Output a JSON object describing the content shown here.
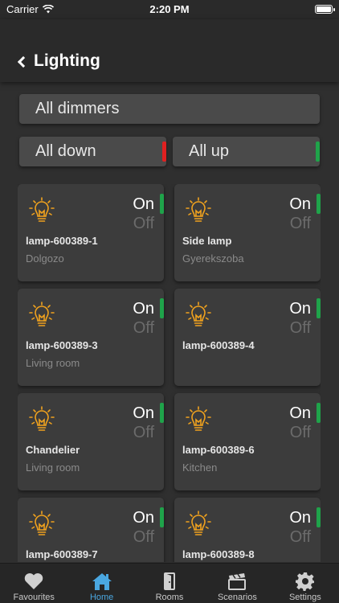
{
  "status_bar": {
    "carrier": "Carrier",
    "time": "2:20 PM"
  },
  "nav": {
    "title": "Lighting"
  },
  "controls": {
    "all_dimmers": "All dimmers",
    "all_down": "All down",
    "all_up": "All up",
    "all_down_indicator_color": "#e02020",
    "all_up_indicator_color": "#1fa34a"
  },
  "on_label": "On",
  "off_label": "Off",
  "lamps": [
    {
      "name": "lamp-600389-1",
      "room": "Dolgozo",
      "state": "on"
    },
    {
      "name": "Side lamp",
      "room": "Gyerekszoba",
      "state": "on"
    },
    {
      "name": "lamp-600389-3",
      "room": "Living room",
      "state": "on"
    },
    {
      "name": "lamp-600389-4",
      "room": "",
      "state": "on"
    },
    {
      "name": "Chandelier",
      "room": "Living room",
      "state": "on"
    },
    {
      "name": "lamp-600389-6",
      "room": "Kitchen",
      "state": "on"
    },
    {
      "name": "lamp-600389-7",
      "room": "",
      "state": "on"
    },
    {
      "name": "lamp-600389-8",
      "room": "",
      "state": "on"
    }
  ],
  "tabs": [
    {
      "label": "Favourites",
      "icon": "heart-icon",
      "active": false
    },
    {
      "label": "Home",
      "icon": "home-icon",
      "active": true
    },
    {
      "label": "Rooms",
      "icon": "door-icon",
      "active": false
    },
    {
      "label": "Scenarios",
      "icon": "clapperboard-icon",
      "active": false
    },
    {
      "label": "Settings",
      "icon": "gear-icon",
      "active": false
    }
  ],
  "colors": {
    "accent": "#4aa7e0",
    "on_indicator": "#1fa34a",
    "bulb": "#f0a21e"
  }
}
